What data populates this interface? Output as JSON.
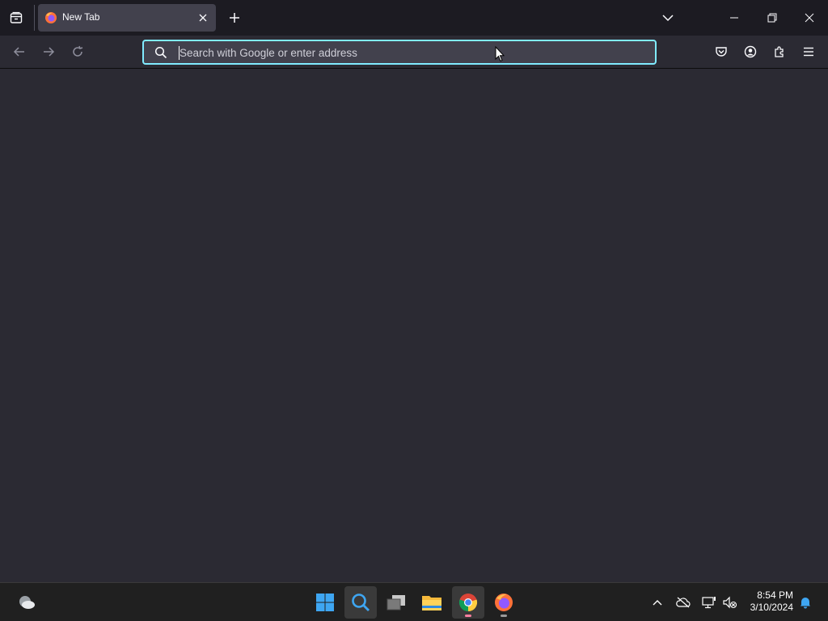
{
  "window": {
    "tab": {
      "title": "New Tab"
    }
  },
  "urlbar": {
    "placeholder": "Search with Google or enter address",
    "value": ""
  },
  "taskbar": {
    "time": "8:54 PM",
    "date": "3/10/2024"
  },
  "colors": {
    "titlebar": "#1c1b22",
    "toolbar": "#2b2a33",
    "urlbar_focus": "#80ebff",
    "taskbar": "#202020"
  }
}
